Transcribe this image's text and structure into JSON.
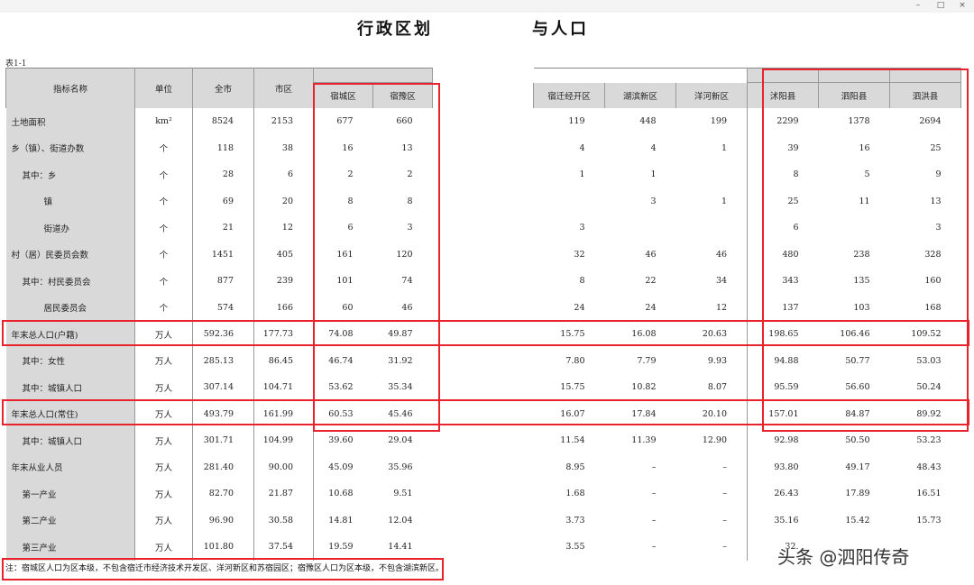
{
  "window": {
    "minimize_glyph": "–",
    "maximize_glyph": "□",
    "close_glyph": "×"
  },
  "title_left": "行政区划",
  "title_right": "与人口",
  "table_no": "表1-1",
  "header": {
    "indicator": "指标名称",
    "unit": "单位",
    "city": "全市",
    "urban": "市区",
    "sucheng": "宿城区",
    "suyu": "宿豫区",
    "econ": "宿迁经开区",
    "hubin": "湖滨新区",
    "yanghe": "洋河新区",
    "shuyang": "沭阳县",
    "siyang": "泗阳县",
    "sihong": "泗洪县"
  },
  "rows": [
    {
      "name": "土地面积",
      "unit": "km²",
      "city": "8524",
      "urban": "2153",
      "sucheng": "677",
      "suyu": "660",
      "econ": "119",
      "hubin": "448",
      "yanghe": "199",
      "shuyang": "2299",
      "siyang": "1378",
      "sihong": "2694",
      "indent": 0
    },
    {
      "name": "乡（镇）、街道办数",
      "unit": "个",
      "city": "118",
      "urban": "38",
      "sucheng": "16",
      "suyu": "13",
      "econ": "4",
      "hubin": "4",
      "yanghe": "1",
      "shuyang": "39",
      "siyang": "16",
      "sihong": "25",
      "indent": 0
    },
    {
      "name": "其中：乡",
      "unit": "个",
      "city": "28",
      "urban": "6",
      "sucheng": "2",
      "suyu": "2",
      "econ": "1",
      "hubin": "1",
      "yanghe": "",
      "shuyang": "8",
      "siyang": "5",
      "sihong": "9",
      "indent": 1
    },
    {
      "name": "镇",
      "unit": "个",
      "city": "69",
      "urban": "20",
      "sucheng": "8",
      "suyu": "8",
      "econ": "",
      "hubin": "3",
      "yanghe": "1",
      "shuyang": "25",
      "siyang": "11",
      "sihong": "13",
      "indent": 2
    },
    {
      "name": "街道办",
      "unit": "个",
      "city": "21",
      "urban": "12",
      "sucheng": "6",
      "suyu": "3",
      "econ": "3",
      "hubin": "",
      "yanghe": "",
      "shuyang": "6",
      "siyang": "",
      "sihong": "3",
      "indent": 2
    },
    {
      "name": "村（居）民委员会数",
      "unit": "个",
      "city": "1451",
      "urban": "405",
      "sucheng": "161",
      "suyu": "120",
      "econ": "32",
      "hubin": "46",
      "yanghe": "46",
      "shuyang": "480",
      "siyang": "238",
      "sihong": "328",
      "indent": 0
    },
    {
      "name": "其中：村民委员会",
      "unit": "个",
      "city": "877",
      "urban": "239",
      "sucheng": "101",
      "suyu": "74",
      "econ": "8",
      "hubin": "22",
      "yanghe": "34",
      "shuyang": "343",
      "siyang": "135",
      "sihong": "160",
      "indent": 1
    },
    {
      "name": "居民委员会",
      "unit": "个",
      "city": "574",
      "urban": "166",
      "sucheng": "60",
      "suyu": "46",
      "econ": "24",
      "hubin": "24",
      "yanghe": "12",
      "shuyang": "137",
      "siyang": "103",
      "sihong": "168",
      "indent": 2
    },
    {
      "name": "年末总人口(户籍)",
      "unit": "万人",
      "city": "592.36",
      "urban": "177.73",
      "sucheng": "74.08",
      "suyu": "49.87",
      "econ": "15.75",
      "hubin": "16.08",
      "yanghe": "20.63",
      "shuyang": "198.65",
      "siyang": "106.46",
      "sihong": "109.52",
      "indent": 0
    },
    {
      "name": "其中：女性",
      "unit": "万人",
      "city": "285.13",
      "urban": "86.45",
      "sucheng": "46.74",
      "suyu": "31.92",
      "econ": "7.80",
      "hubin": "7.79",
      "yanghe": "9.93",
      "shuyang": "94.88",
      "siyang": "50.77",
      "sihong": "53.03",
      "indent": 1
    },
    {
      "name": "其中：城镇人口",
      "unit": "万人",
      "city": "307.14",
      "urban": "104.71",
      "sucheng": "53.62",
      "suyu": "35.34",
      "econ": "15.75",
      "hubin": "10.82",
      "yanghe": "8.07",
      "shuyang": "95.59",
      "siyang": "56.60",
      "sihong": "50.24",
      "indent": 1
    },
    {
      "name": "年末总人口(常住)",
      "unit": "万人",
      "city": "493.79",
      "urban": "161.99",
      "sucheng": "60.53",
      "suyu": "45.46",
      "econ": "16.07",
      "hubin": "17.84",
      "yanghe": "20.10",
      "shuyang": "157.01",
      "siyang": "84.87",
      "sihong": "89.92",
      "indent": 0
    },
    {
      "name": "其中：城镇人口",
      "unit": "万人",
      "city": "301.71",
      "urban": "104.99",
      "sucheng": "39.60",
      "suyu": "29.04",
      "econ": "11.54",
      "hubin": "11.39",
      "yanghe": "12.90",
      "shuyang": "92.98",
      "siyang": "50.50",
      "sihong": "53.23",
      "indent": 1
    },
    {
      "name": "年末从业人员",
      "unit": "万人",
      "city": "281.40",
      "urban": "90.00",
      "sucheng": "45.09",
      "suyu": "35.96",
      "econ": "8.95",
      "hubin": "–",
      "yanghe": "–",
      "shuyang": "93.80",
      "siyang": "49.17",
      "sihong": "48.43",
      "indent": 0
    },
    {
      "name": "第一产业",
      "unit": "万人",
      "city": "82.70",
      "urban": "21.87",
      "sucheng": "10.68",
      "suyu": "9.51",
      "econ": "1.68",
      "hubin": "–",
      "yanghe": "–",
      "shuyang": "26.43",
      "siyang": "17.89",
      "sihong": "16.51",
      "indent": 1
    },
    {
      "name": "第二产业",
      "unit": "万人",
      "city": "96.90",
      "urban": "30.58",
      "sucheng": "14.81",
      "suyu": "12.04",
      "econ": "3.73",
      "hubin": "–",
      "yanghe": "–",
      "shuyang": "35.16",
      "siyang": "15.42",
      "sihong": "15.73",
      "indent": 1
    },
    {
      "name": "第三产业",
      "unit": "万人",
      "city": "101.80",
      "urban": "37.54",
      "sucheng": "19.59",
      "suyu": "14.41",
      "econ": "3.55",
      "hubin": "–",
      "yanghe": "–",
      "shuyang": "32.",
      "siyang": "",
      "sihong": "",
      "indent": 1
    }
  ],
  "footnote": "注：宿城区人口为区本级，不包含宿迁市经济技术开发区、洋河新区和苏宿园区；宿豫区人口为区本级，不包含湖滨新区。",
  "watermark": "头条 @泗阳传奇",
  "highlight_color": "#e8232b"
}
